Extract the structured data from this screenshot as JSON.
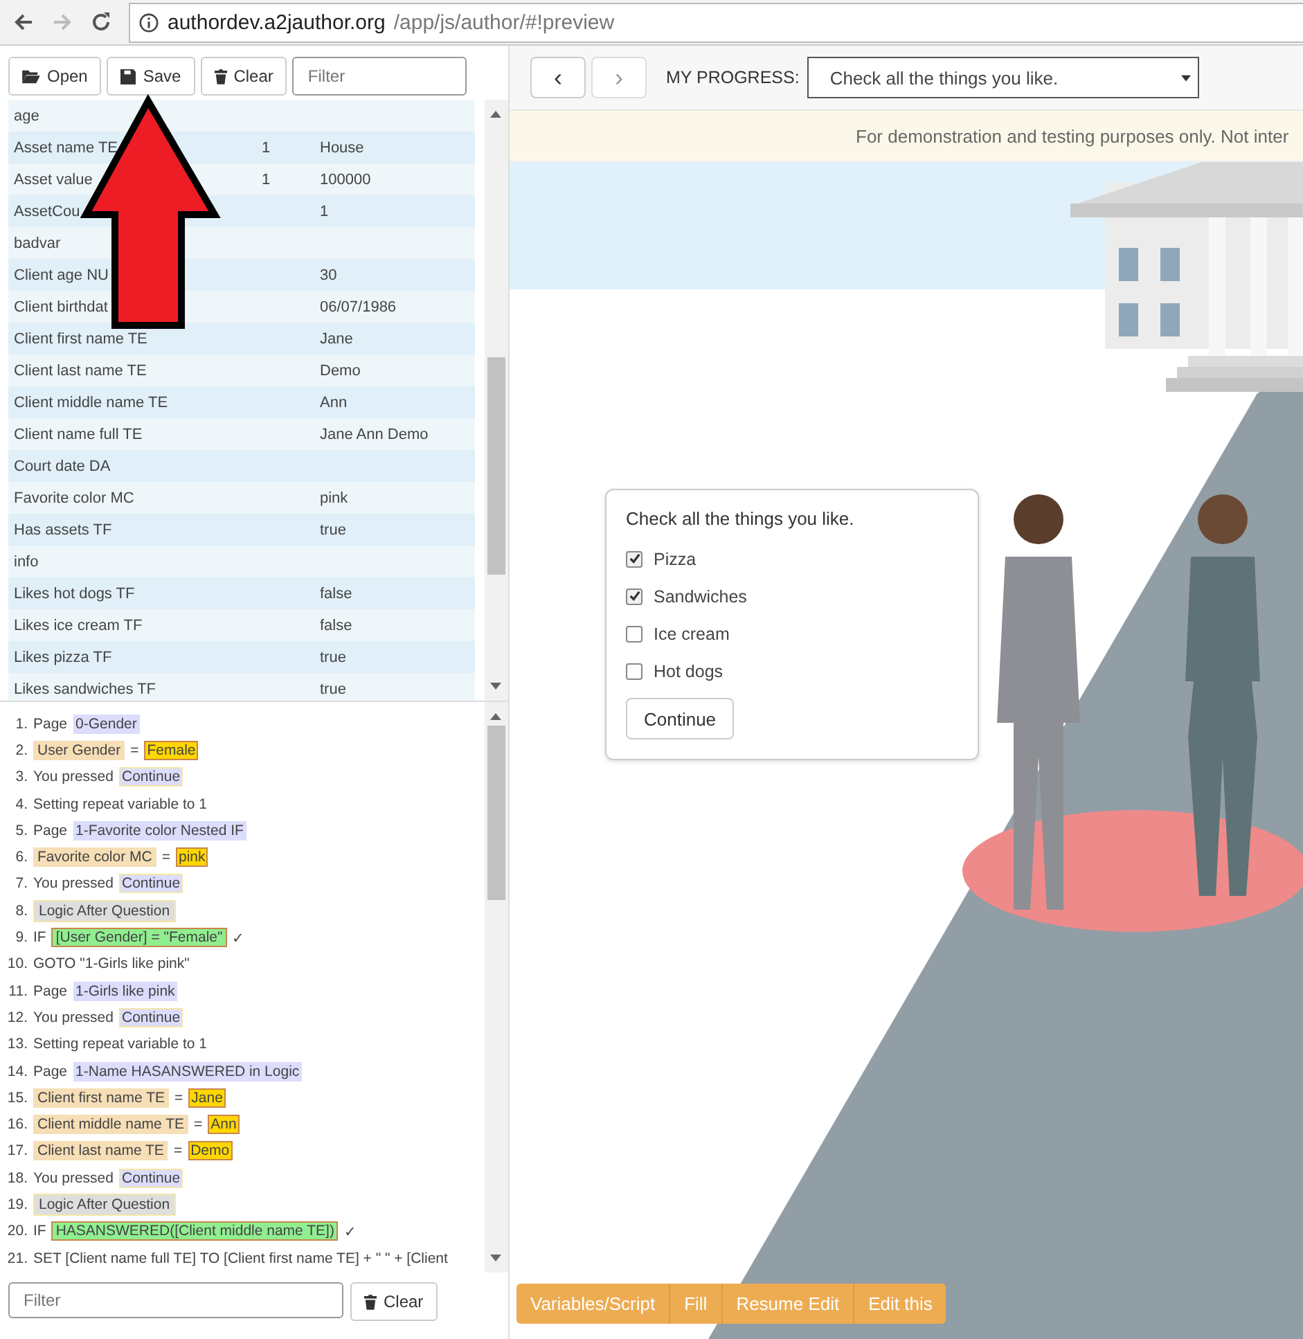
{
  "browser": {
    "url_host": "authordev.a2jauthor.org",
    "url_path": "/app/js/author/#!preview"
  },
  "toolbar": {
    "buttons": [
      {
        "kind": "open",
        "label": "Open"
      },
      {
        "kind": "save",
        "label": "Save"
      },
      {
        "kind": "clear",
        "label": "Clear"
      }
    ],
    "filter": {
      "placeholder": "Filter"
    }
  },
  "variables": [
    {
      "name": "age"
    },
    {
      "name": "Asset name TE",
      "count": "1",
      "value": "House"
    },
    {
      "name": "Asset value",
      "count": "1",
      "value": "100000"
    },
    {
      "name": "AssetCou",
      "value": "1"
    },
    {
      "name": "badvar"
    },
    {
      "name": "Client age NU",
      "value": "30"
    },
    {
      "name": "Client birthdat",
      "value": "06/07/1986"
    },
    {
      "name": "Client first name TE",
      "value": "Jane"
    },
    {
      "name": "Client last name TE",
      "value": "Demo"
    },
    {
      "name": "Client middle name TE",
      "value": "Ann"
    },
    {
      "name": "Client name full TE",
      "value": "Jane Ann Demo"
    },
    {
      "name": "Court date DA"
    },
    {
      "name": "Favorite color MC",
      "value": "pink"
    },
    {
      "name": "Has assets TF",
      "value": "true"
    },
    {
      "name": "info"
    },
    {
      "name": "Likes hot dogs TF",
      "value": "false"
    },
    {
      "name": "Likes ice cream TF",
      "value": "false"
    },
    {
      "name": "Likes pizza TF",
      "value": "true"
    },
    {
      "name": "Likes sandwiches TF",
      "value": "true"
    }
  ],
  "log": [
    {
      "number": "1.",
      "parts": [
        {
          "kind": "text",
          "text": "Page"
        },
        {
          "kind": "page",
          "text": "0-Gender"
        }
      ]
    },
    {
      "number": "2.",
      "parts": [
        {
          "kind": "var",
          "text": "User Gender"
        },
        {
          "kind": "text",
          "text": "="
        },
        {
          "kind": "value",
          "text": "Female"
        }
      ]
    },
    {
      "number": "3.",
      "parts": [
        {
          "kind": "text",
          "text": "You pressed"
        },
        {
          "kind": "button",
          "text": "Continue"
        }
      ]
    },
    {
      "number": "4.",
      "parts": [
        {
          "kind": "text",
          "text": "Setting repeat variable to 1"
        }
      ]
    },
    {
      "number": "5.",
      "parts": [
        {
          "kind": "text",
          "text": "Page"
        },
        {
          "kind": "page",
          "text": "1-Favorite color Nested IF"
        }
      ]
    },
    {
      "number": "6.",
      "parts": [
        {
          "kind": "var",
          "text": "Favorite color MC"
        },
        {
          "kind": "text",
          "text": "="
        },
        {
          "kind": "value",
          "text": "pink"
        }
      ]
    },
    {
      "number": "7.",
      "parts": [
        {
          "kind": "text",
          "text": "You pressed"
        },
        {
          "kind": "button",
          "text": "Continue"
        }
      ]
    },
    {
      "number": "8.",
      "parts": [
        {
          "kind": "logic",
          "text": "Logic After Question"
        }
      ]
    },
    {
      "number": "9.",
      "parts": [
        {
          "kind": "text",
          "text": "IF"
        },
        {
          "kind": "cond",
          "text": "[User Gender] = \"Female\""
        },
        {
          "kind": "text",
          "text": "✓"
        }
      ]
    },
    {
      "number": "10.",
      "parts": [
        {
          "kind": "text",
          "text": "GOTO \"1-Girls like pink\""
        }
      ]
    },
    {
      "number": "11.",
      "parts": [
        {
          "kind": "text",
          "text": "Page"
        },
        {
          "kind": "page",
          "text": "1-Girls like pink"
        }
      ]
    },
    {
      "number": "12.",
      "parts": [
        {
          "kind": "text",
          "text": "You pressed"
        },
        {
          "kind": "button",
          "text": "Continue"
        }
      ]
    },
    {
      "number": "13.",
      "parts": [
        {
          "kind": "text",
          "text": "Setting repeat variable to 1"
        }
      ]
    },
    {
      "number": "14.",
      "parts": [
        {
          "kind": "text",
          "text": "Page"
        },
        {
          "kind": "page",
          "text": "1-Name HASANSWERED in Logic"
        }
      ]
    },
    {
      "number": "15.",
      "parts": [
        {
          "kind": "var",
          "text": "Client first name TE"
        },
        {
          "kind": "text",
          "text": "="
        },
        {
          "kind": "value",
          "text": "Jane"
        }
      ]
    },
    {
      "number": "16.",
      "parts": [
        {
          "kind": "var",
          "text": "Client middle name TE"
        },
        {
          "kind": "text",
          "text": "="
        },
        {
          "kind": "value",
          "text": "Ann"
        }
      ]
    },
    {
      "number": "17.",
      "parts": [
        {
          "kind": "var",
          "text": "Client last name TE"
        },
        {
          "kind": "text",
          "text": "="
        },
        {
          "kind": "value",
          "text": "Demo"
        }
      ]
    },
    {
      "number": "18.",
      "parts": [
        {
          "kind": "text",
          "text": "You pressed"
        },
        {
          "kind": "button",
          "text": "Continue"
        }
      ]
    },
    {
      "number": "19.",
      "parts": [
        {
          "kind": "logic",
          "text": "Logic After Question"
        }
      ]
    },
    {
      "number": "20.",
      "parts": [
        {
          "kind": "text",
          "text": "IF"
        },
        {
          "kind": "cond",
          "text": "HASANSWERED([Client middle name TE])"
        },
        {
          "kind": "text",
          "text": "✓"
        }
      ]
    },
    {
      "number": "21.",
      "parts": [
        {
          "kind": "text",
          "text": "SET [Client name full TE] TO [Client first name TE] + \" \" + [Client"
        }
      ]
    }
  ],
  "bottom": {
    "filter": {
      "placeholder": "Filter"
    },
    "clear": "Clear"
  },
  "nav": {
    "prev": "‹",
    "next": "›",
    "progress_label": "MY PROGRESS:",
    "progress_value": "Check all the things you like."
  },
  "notice": "For demonstration and testing purposes only. Not inter",
  "question": {
    "prompt": "Check all the things you like.",
    "options": [
      {
        "label": "Pizza",
        "checked": true
      },
      {
        "label": "Sandwiches",
        "checked": true
      },
      {
        "label": "Ice cream",
        "checked": false
      },
      {
        "label": "Hot dogs",
        "checked": false
      }
    ],
    "button": "Continue"
  },
  "actions": [
    "Variables/Script",
    "Fill",
    "Resume Edit",
    "Edit this"
  ]
}
